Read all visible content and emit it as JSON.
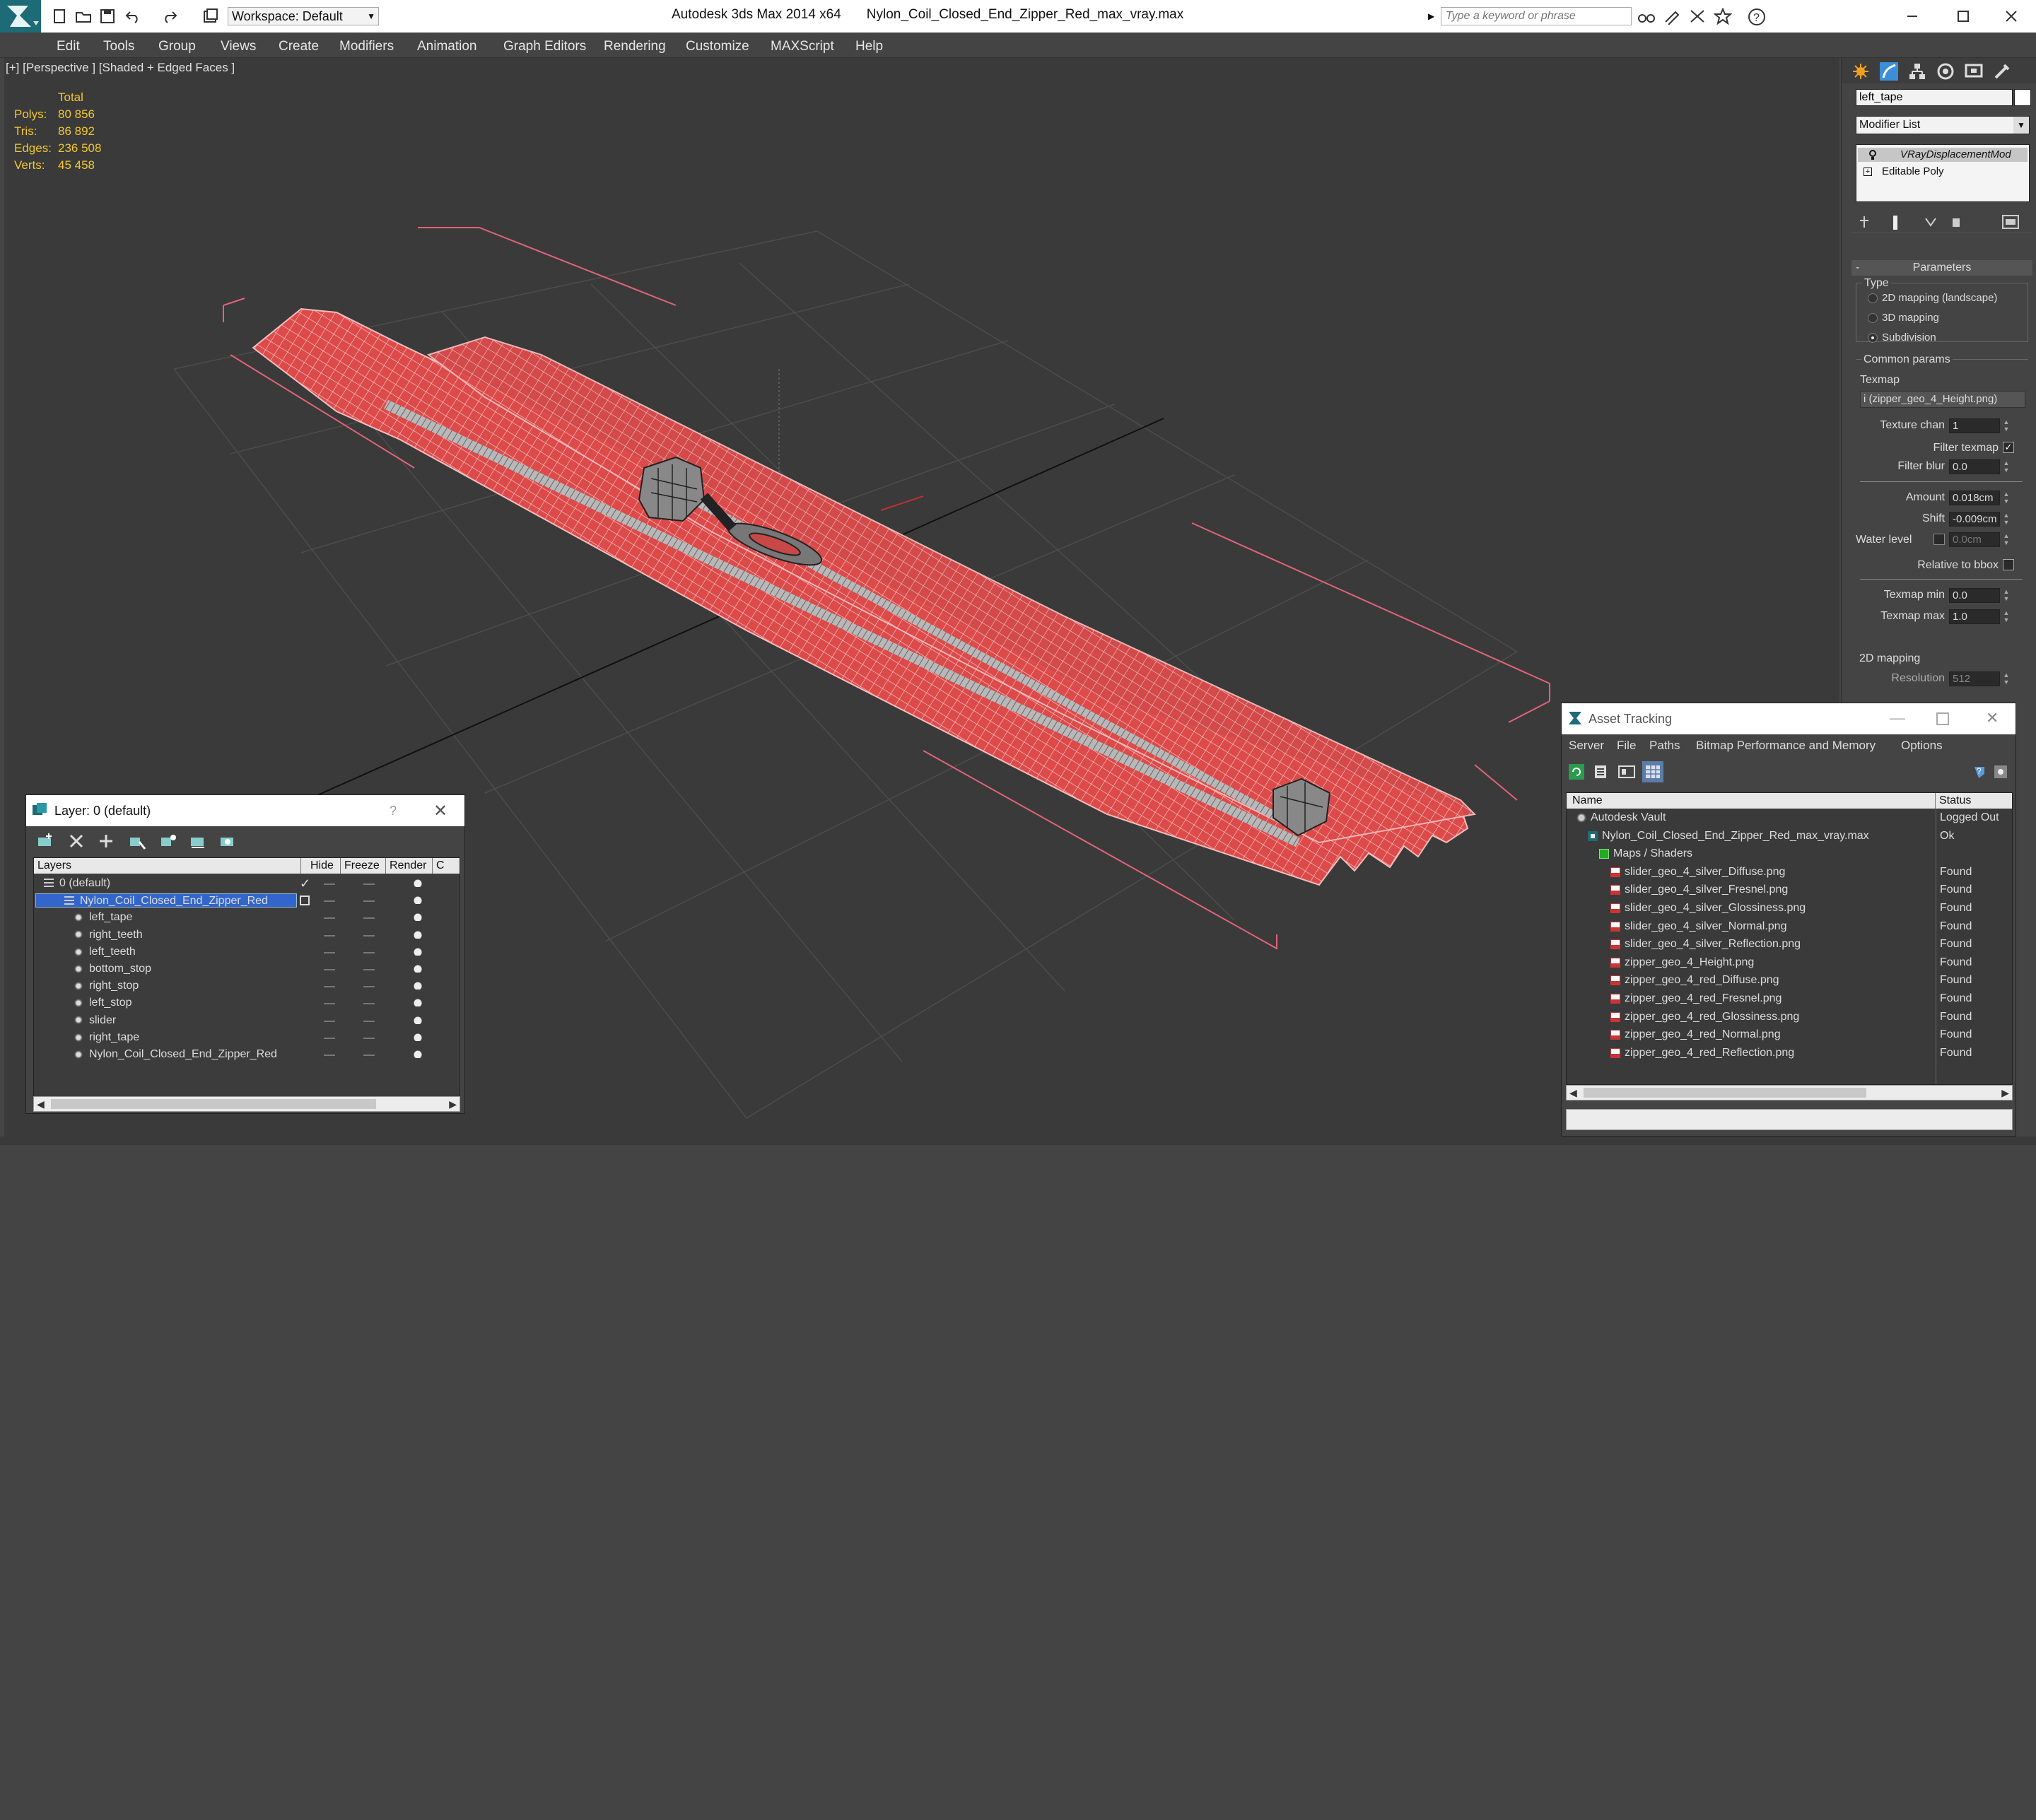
{
  "app": {
    "title": "Autodesk 3ds Max 2014 x64",
    "file": "Nylon_Coil_Closed_End_Zipper_Red_max_vray.max",
    "workspace": "Workspace: Default",
    "search_placeholder": "Type a keyword or phrase"
  },
  "menu": [
    "Edit",
    "Tools",
    "Group",
    "Views",
    "Create",
    "Modifiers",
    "Animation",
    "Graph Editors",
    "Rendering",
    "Customize",
    "MAXScript",
    "Help"
  ],
  "viewport": {
    "label": "[+] [Perspective ] [Shaded + Edged Faces ]",
    "stats": {
      "header": "Total",
      "rows": [
        {
          "label": "Polys:",
          "value": "80 856"
        },
        {
          "label": "Tris:",
          "value": "86 892"
        },
        {
          "label": "Edges:",
          "value": "236 508"
        },
        {
          "label": "Verts:",
          "value": "45 458"
        }
      ]
    },
    "mesh_color": "#e04a4a"
  },
  "cmd": {
    "object_name": "left_tape",
    "modifier_list": "Modifier List",
    "stack": [
      "VRayDisplacementMod",
      "Editable Poly"
    ],
    "rollout": "Parameters",
    "type_label": "Type",
    "types": [
      "2D mapping (landscape)",
      "3D mapping",
      "Subdivision"
    ],
    "selected_type": 2,
    "common_label": "Common params",
    "texmap_label": "Texmap",
    "texmap_value": "i (zipper_geo_4_Height.png)",
    "texture_chan_label": "Texture chan",
    "texture_chan_value": "1",
    "filter_texmap_label": "Filter texmap",
    "filter_blur_label": "Filter blur",
    "filter_blur_value": "0.0",
    "amount_label": "Amount",
    "amount_value": "0.018cm",
    "shift_label": "Shift",
    "shift_value": "-0.009cm",
    "water_label": "Water level",
    "water_value": "0.0cm",
    "relative_label": "Relative to bbox",
    "texmin_label": "Texmap min",
    "texmin_value": "0.0",
    "texmax_label": "Texmap max",
    "texmax_value": "1.0",
    "mapping2d_label": "2D mapping",
    "resolution_label": "Resolution",
    "resolution_value": "512"
  },
  "layer": {
    "title": "Layer: 0 (default)",
    "help": "?",
    "cols": [
      "Layers",
      "Hide",
      "Freeze",
      "Render",
      "C"
    ],
    "rows": [
      {
        "name": "0 (default)",
        "indent": 0,
        "type": "layer",
        "check": true
      },
      {
        "name": "Nylon_Coil_Closed_End_Zipper_Red",
        "indent": 0,
        "type": "layer",
        "selected": true
      },
      {
        "name": "left_tape",
        "indent": 1,
        "type": "obj"
      },
      {
        "name": "right_teeth",
        "indent": 1,
        "type": "obj"
      },
      {
        "name": "left_teeth",
        "indent": 1,
        "type": "obj"
      },
      {
        "name": "bottom_stop",
        "indent": 1,
        "type": "obj"
      },
      {
        "name": "right_stop",
        "indent": 1,
        "type": "obj"
      },
      {
        "name": "left_stop",
        "indent": 1,
        "type": "obj"
      },
      {
        "name": "slider",
        "indent": 1,
        "type": "obj"
      },
      {
        "name": "right_tape",
        "indent": 1,
        "type": "obj"
      },
      {
        "name": "Nylon_Coil_Closed_End_Zipper_Red",
        "indent": 1,
        "type": "obj"
      }
    ]
  },
  "asset": {
    "title": "Asset Tracking",
    "menu": [
      "Server",
      "File",
      "Paths",
      "Bitmap Performance and Memory",
      "Options"
    ],
    "cols": [
      "Name",
      "Status"
    ],
    "rows": [
      {
        "name": "Autodesk Vault",
        "status": "Logged Out",
        "indent": 0,
        "icon": "vault"
      },
      {
        "name": "Nylon_Coil_Closed_End_Zipper_Red_max_vray.max",
        "status": "Ok",
        "indent": 1,
        "icon": "max"
      },
      {
        "name": "Maps / Shaders",
        "status": "",
        "indent": 2,
        "icon": "maps"
      },
      {
        "name": "slider_geo_4_silver_Diffuse.png",
        "status": "Found",
        "indent": 3,
        "icon": "png"
      },
      {
        "name": "slider_geo_4_silver_Fresnel.png",
        "status": "Found",
        "indent": 3,
        "icon": "png"
      },
      {
        "name": "slider_geo_4_silver_Glossiness.png",
        "status": "Found",
        "indent": 3,
        "icon": "png"
      },
      {
        "name": "slider_geo_4_silver_Normal.png",
        "status": "Found",
        "indent": 3,
        "icon": "png"
      },
      {
        "name": "slider_geo_4_silver_Reflection.png",
        "status": "Found",
        "indent": 3,
        "icon": "png"
      },
      {
        "name": "zipper_geo_4_Height.png",
        "status": "Found",
        "indent": 3,
        "icon": "png"
      },
      {
        "name": "zipper_geo_4_red_Diffuse.png",
        "status": "Found",
        "indent": 3,
        "icon": "png"
      },
      {
        "name": "zipper_geo_4_red_Fresnel.png",
        "status": "Found",
        "indent": 3,
        "icon": "png"
      },
      {
        "name": "zipper_geo_4_red_Glossiness.png",
        "status": "Found",
        "indent": 3,
        "icon": "png"
      },
      {
        "name": "zipper_geo_4_red_Normal.png",
        "status": "Found",
        "indent": 3,
        "icon": "png"
      },
      {
        "name": "zipper_geo_4_red_Reflection.png",
        "status": "Found",
        "indent": 3,
        "icon": "png"
      }
    ]
  }
}
